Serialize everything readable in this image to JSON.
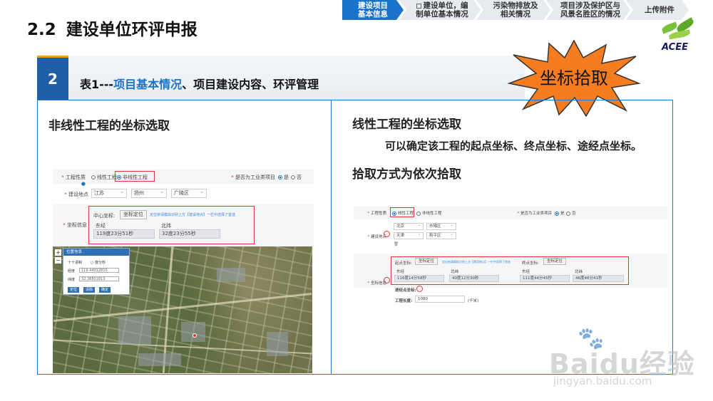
{
  "slide": {
    "number": "2.2",
    "title": "建设单位环评申报"
  },
  "steps": [
    {
      "line1": "建设项目",
      "line2": "基本信息"
    },
    {
      "line1": "建设单位，编",
      "line2": "制单位基本情况"
    },
    {
      "line1": "污染物排放及",
      "line2": "相关情况"
    },
    {
      "line1": "项目涉及保护区与",
      "line2": "风景名胜区的情况"
    },
    {
      "line1": "上传附件",
      "line2": ""
    }
  ],
  "logo": {
    "text": "ACEE"
  },
  "section": {
    "badge": "2",
    "heading_prefix": "表1---",
    "heading_highlight": "项目基本情况",
    "heading_suffix": "、项目建设内容、环评管理"
  },
  "callout": "坐标拾取",
  "left_panel": {
    "title": "非线性工程的坐标选取",
    "form": {
      "project_nature_label": "工程性质",
      "option_linear": "线性工程",
      "option_nonlinear": "非线性工程",
      "industrial_label": "是否为工业类项目",
      "yes": "是",
      "no": "否",
      "location_label": "建设地点",
      "province": "江苏",
      "city": "扬州",
      "district": "广陵区",
      "coord_label": "坐标信息",
      "center_label": "中心坐标:",
      "locate_button": "坐标定位",
      "hint": "定位依请模拟识别上方【建设地点】一栏中选择了首选",
      "lng_label": "东经",
      "lat_label": "北纬",
      "lng_value": "119度23分51秒",
      "lat_value": "32度23分55秒"
    },
    "map_popup": {
      "title": "位置信息",
      "mode_decimal": "十十进制",
      "mode_dms": "度分秒",
      "lng_label": "经度",
      "lng_value": "119.44012810",
      "lat_label": "纬度",
      "lat_value": "32.38801813",
      "btn_locate": "定位",
      "btn_clear": "清除",
      "btn_confirm": "确定"
    }
  },
  "right_panel": {
    "title": "线性工程的坐标选取",
    "description": "可以确定该工程的起点坐标、终点坐标、途经点坐标。",
    "method": "拾取方式为依次拾取",
    "form": {
      "project_nature_label": "工程性质",
      "option_linear": "线性工程",
      "option_nonlinear": "非线性工程",
      "industrial_label": "是否为工业类项目",
      "yes": "是",
      "no": "否",
      "location_label": "建设地点",
      "province1": "北京",
      "district1": "市辖区",
      "province2": "天津",
      "district2": "和平区",
      "coord_label": "坐标信息",
      "start_label": "起点坐标:",
      "end_label": "终点坐标:",
      "locate_button": "坐标定位",
      "hint": "定位依请模拟识别上方【建设地点】一栏中选择了首选",
      "lng_label": "东经",
      "lat_label": "北纬",
      "start_lng": "116度14分58秒",
      "start_lat": "40度12分30秒",
      "end_lng": "111度44分45秒",
      "end_lat": "46度46分41秒",
      "waypoint_label": "途经点坐标:",
      "length_label": "工程长度:",
      "length_value": "1080",
      "length_unit": "(千米)"
    }
  },
  "watermark": {
    "brand": "Baidu经验",
    "url": "jingyan.baidu.com"
  }
}
